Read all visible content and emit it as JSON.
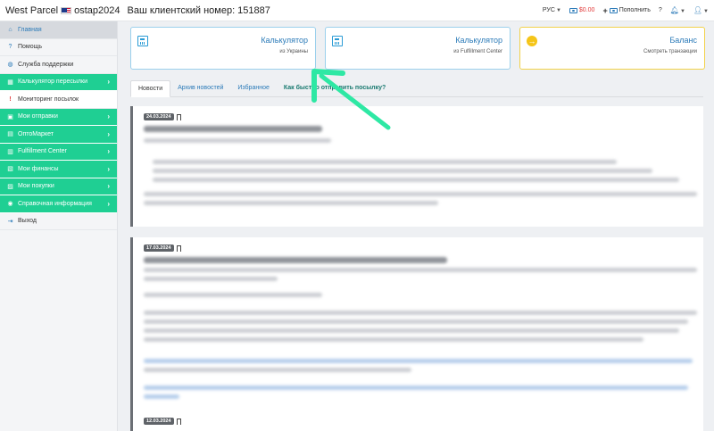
{
  "topbar": {
    "brand": "West Parcel",
    "username": "ostap2024",
    "client_number_label": "Ваш клиентский номер: 151887",
    "language": "РУС",
    "balance": "$0.00",
    "topup_label": "Пополнить",
    "help": "?"
  },
  "sidebar": {
    "items": [
      {
        "label": "Главная",
        "icon": "home-icon"
      },
      {
        "label": "Помощь",
        "icon": "question-icon"
      },
      {
        "label": "Служба поддержки",
        "icon": "globe-icon"
      },
      {
        "label": "Калькулятор пересылки",
        "icon": "calculator-icon"
      },
      {
        "label": "Мониторинг посылок",
        "icon": "exclamation-icon"
      },
      {
        "label": "Мои отправки",
        "icon": "box-icon"
      },
      {
        "label": "ОптоМаркет",
        "icon": "cart-icon"
      },
      {
        "label": "Fulfillment Center",
        "icon": "warehouse-icon"
      },
      {
        "label": "Мои финансы",
        "icon": "wallet-icon"
      },
      {
        "label": "Мои покупки",
        "icon": "bag-icon"
      },
      {
        "label": "Справочная информация",
        "icon": "info-icon"
      },
      {
        "label": "Выход",
        "icon": "logout-icon"
      }
    ]
  },
  "cards": [
    {
      "title": "Калькулятор",
      "subtitle": "из Украины",
      "icon": "calculator-icon"
    },
    {
      "title": "Калькулятор",
      "subtitle": "из Fulfillment Center",
      "icon": "calculator-icon"
    },
    {
      "title": "Баланс",
      "subtitle": "Смотреть транзакции",
      "icon": "arrow-right-circle-icon"
    }
  ],
  "tabs": [
    {
      "label": "Новости"
    },
    {
      "label": "Архив новостей"
    },
    {
      "label": "Избранное"
    },
    {
      "label": "Как быстро отправить посылку?"
    }
  ],
  "news": [
    {
      "date": "24.03.2024"
    },
    {
      "date": "17.03.2024"
    },
    {
      "date": "12.03.2024"
    }
  ],
  "colors": {
    "accent_green": "#1fcf93",
    "link_blue": "#2a7ab8",
    "balance_red": "#e23b3b",
    "annotation_arrow": "#2ee8a4"
  }
}
